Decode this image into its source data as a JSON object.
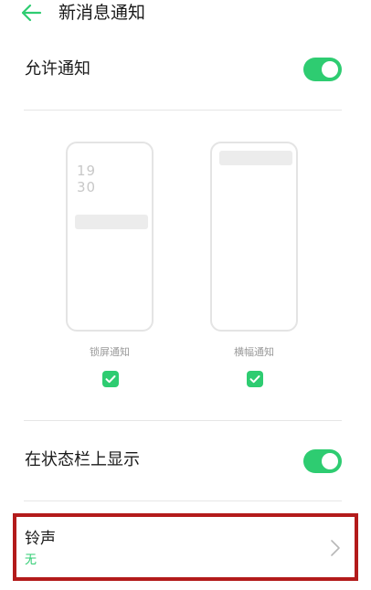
{
  "header": {
    "title": "新消息通知"
  },
  "allow_notifications": {
    "label": "允许通知",
    "enabled": true
  },
  "styles": {
    "lock_screen": {
      "label": "锁屏通知",
      "time_hour": "19",
      "time_minute": "30",
      "checked": true
    },
    "banner": {
      "label": "横幅通知",
      "checked": true
    }
  },
  "status_bar": {
    "label": "在状态栏上显示",
    "enabled": true
  },
  "ringtone": {
    "label": "铃声",
    "value": "无"
  },
  "colors": {
    "accent": "#2ecc71",
    "highlight": "#b31b1b"
  }
}
